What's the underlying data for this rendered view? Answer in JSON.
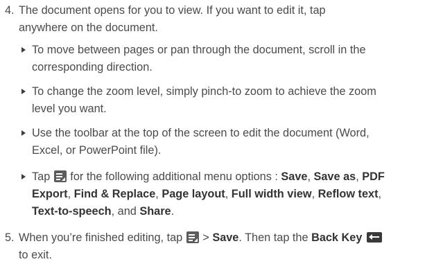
{
  "steps": {
    "step4": {
      "number": "4.",
      "line1": "The document opens for you to view. If you want to edit it, tap",
      "line2": "anywhere on the document."
    },
    "bullets": [
      {
        "line1": "To move between pages or pan through the document, scroll in the",
        "line2": "corresponding direction."
      },
      {
        "line1": "To change the zoom level, simply pinch-to zoom to achieve the zoom",
        "line2": "level you want."
      },
      {
        "line1": "Use the toolbar at the top of the screen to edit the document (Word,",
        "line2": "Excel, or PowerPoint file)."
      }
    ],
    "menu_bullet": {
      "tap": "Tap",
      "after_icon": " for the following additional menu options : ",
      "save": "Save",
      "save_as": "Save as",
      "pdf": "PDF",
      "export": "Export",
      "find_replace": "Find & Replace",
      "page_layout": "Page layout",
      "full_width": "Full width view",
      "reflow": "Reflow text",
      "tts": "Text-to-speech",
      "and": ", and ",
      "share": "Share"
    },
    "step5": {
      "number": "5.",
      "text1": "When you’re finished editing, tap",
      "gt": " > ",
      "save": "Save",
      "text2": ". Then tap the ",
      "back_key": "Back Key",
      "line2": "to exit."
    }
  },
  "icons": {
    "menu": "menu-icon",
    "back": "back-key-icon"
  }
}
